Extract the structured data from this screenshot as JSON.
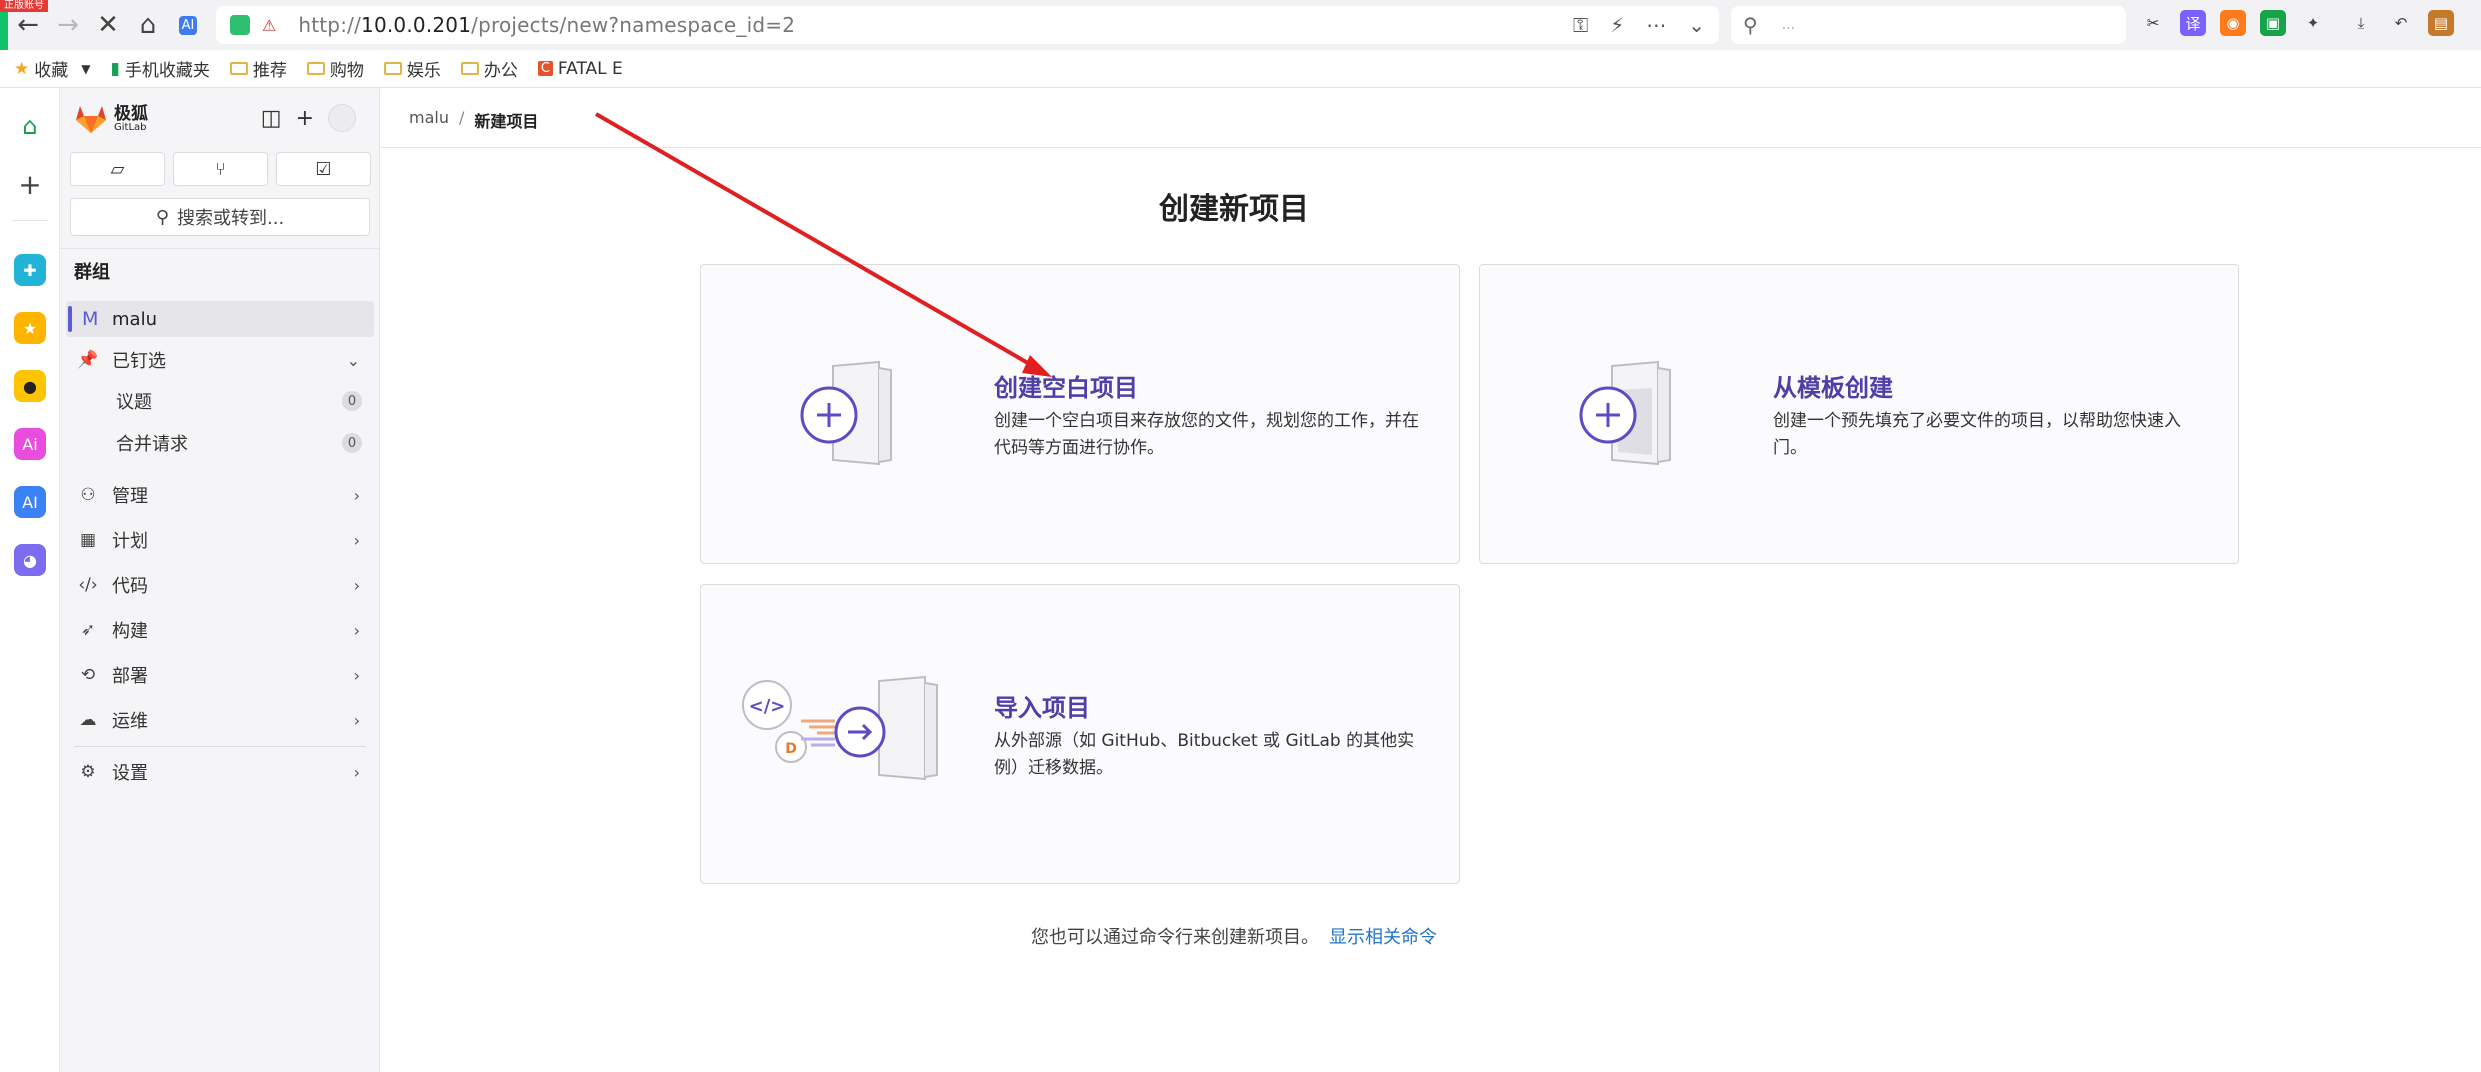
{
  "browser": {
    "badge": "正版账号",
    "url_prefix": "http://",
    "url_host": "10.0.0.201",
    "url_path": "/projects/new?namespace_id=2",
    "search_placeholder": "..."
  },
  "bookmarks": [
    {
      "label": "收藏",
      "icon": "star-icon"
    },
    {
      "label": "手机收藏夹",
      "icon": "phone-icon"
    },
    {
      "label": "推荐",
      "icon": "folder-icon"
    },
    {
      "label": "购物",
      "icon": "folder-icon"
    },
    {
      "label": "娱乐",
      "icon": "folder-icon"
    },
    {
      "label": "办公",
      "icon": "folder-icon"
    },
    {
      "label": "FATAL E",
      "icon": "c-icon"
    }
  ],
  "sidebar": {
    "brand": "极狐",
    "brand_sub": "GitLab",
    "search_label": "搜索或转到...",
    "section_title": "群组",
    "context": {
      "avatar": "M",
      "label": "malu"
    },
    "pinned_label": "已钉选",
    "pinned_items": [
      {
        "label": "议题",
        "count": "0"
      },
      {
        "label": "合并请求",
        "count": "0"
      }
    ],
    "nav": [
      {
        "label": "管理",
        "icon": "users-icon"
      },
      {
        "label": "计划",
        "icon": "calendar-icon"
      },
      {
        "label": "代码",
        "icon": "code-icon"
      },
      {
        "label": "构建",
        "icon": "rocket-icon"
      },
      {
        "label": "部署",
        "icon": "deploy-icon"
      },
      {
        "label": "运维",
        "icon": "cloud-icon"
      }
    ],
    "settings_label": "设置"
  },
  "main": {
    "breadcrumb": [
      "malu",
      "新建项目"
    ],
    "title": "创建新项目",
    "cards": [
      {
        "title": "创建空白项目",
        "desc": "创建一个空白项目来存放您的文件，规划您的工作，并在代码等方面进行协作。"
      },
      {
        "title": "从模板创建",
        "desc": "创建一个预先填充了必要文件的项目，以帮助您快速入门。"
      },
      {
        "title": "导入项目",
        "desc": "从外部源（如 GitHub、Bitbucket 或 GitLab 的其他实例）迁移数据。"
      }
    ],
    "footer_text": "您也可以通过命令行来创建新项目。",
    "footer_link": "显示相关命令"
  },
  "colors": {
    "accent": "#4d3fa6",
    "link": "#1f75cb",
    "annotation_arrow": "#e02020"
  }
}
